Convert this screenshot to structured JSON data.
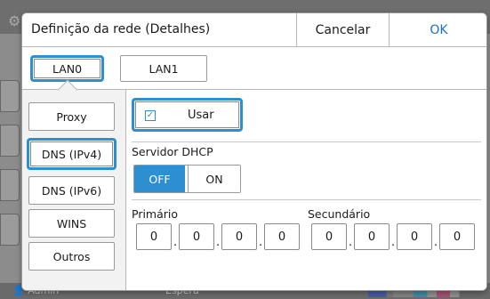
{
  "background_app": {
    "user_label": "Admin",
    "state_label": "Espera"
  },
  "dialog": {
    "title": "Definição da rede (Detalhes)",
    "cancel_label": "Cancelar",
    "ok_label": "OK"
  },
  "lan_tabs": [
    {
      "label": "LAN0",
      "selected": true
    },
    {
      "label": "LAN1",
      "selected": false
    }
  ],
  "side_nav": [
    {
      "label": "Proxy",
      "selected": false
    },
    {
      "label": "DNS (IPv4)",
      "selected": true
    },
    {
      "label": "DNS (IPv6)",
      "selected": false
    },
    {
      "label": "WINS",
      "selected": false
    },
    {
      "label": "Outros",
      "selected": false
    }
  ],
  "content": {
    "use_label": "Usar",
    "use_checked": true,
    "dhcp_label": "Servidor DHCP",
    "dhcp_off_label": "OFF",
    "dhcp_on_label": "ON",
    "dhcp_state": "OFF",
    "primary_label": "Primário",
    "primary_ip": [
      "0",
      "0",
      "0",
      "0"
    ],
    "secondary_label": "Secundário",
    "secondary_ip": [
      "0",
      "0",
      "0",
      "0"
    ]
  },
  "colors": {
    "accent": "#2d8fd0",
    "ok_text": "#1b6fc4",
    "overlay": "#8c8c8c"
  },
  "icons": {
    "checkbox": "check-icon",
    "settings": "gear-icon",
    "user": "user-icon"
  }
}
